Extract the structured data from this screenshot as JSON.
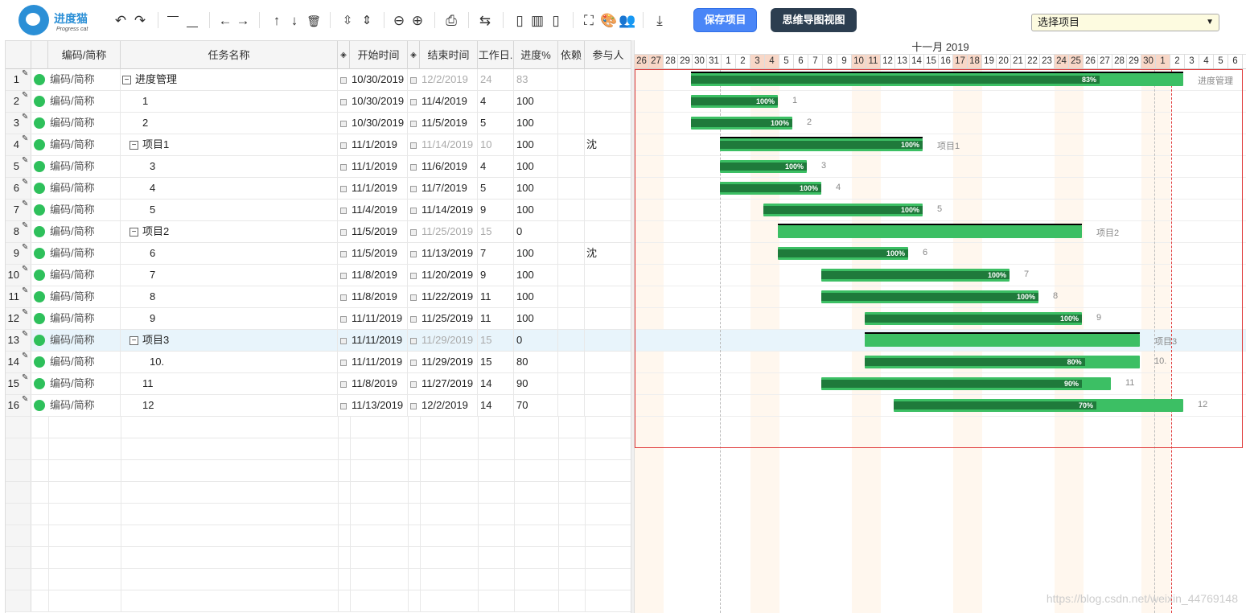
{
  "toolbar": {
    "logo_title": "进度猫",
    "logo_sub": "Progress cat",
    "save_label": "保存项目",
    "mind_label": "思维导图视图",
    "project_select": "选择项目"
  },
  "colors": {
    "bar": "#3cbf64",
    "progress": "#1f7a3b",
    "save_button": "#4a86f7",
    "mind_button": "#2c3e50",
    "status_dot": "#2ec05b",
    "weekend": "#f8d7c7"
  },
  "columns": [
    "编码/简称",
    "任务名称",
    "开始时间",
    "结束时间",
    "工作日.",
    "进度%",
    "依赖",
    "参与人"
  ],
  "tasks": [
    {
      "no": "1",
      "code": "编码/简称",
      "name": "进度管理",
      "start": "10/30/2019",
      "end": "12/2/2019",
      "days": "24",
      "progress": "83",
      "dep": "",
      "who": "",
      "summary": true,
      "level": 0,
      "bar_label": "83%",
      "side": "进度管理",
      "pct": 0.83
    },
    {
      "no": "2",
      "code": "编码/简称",
      "name": "1",
      "start": "10/30/2019",
      "end": "11/4/2019",
      "days": "4",
      "progress": "100",
      "dep": "",
      "who": "",
      "level": 1,
      "bar_label": "100%",
      "side": "1",
      "pct": 1
    },
    {
      "no": "3",
      "code": "编码/简称",
      "name": "2",
      "start": "10/30/2019",
      "end": "11/5/2019",
      "days": "5",
      "progress": "100",
      "dep": "",
      "who": "",
      "level": 1,
      "bar_label": "100%",
      "side": "2",
      "pct": 1
    },
    {
      "no": "4",
      "code": "编码/简称",
      "name": "项目1",
      "start": "11/1/2019",
      "end": "11/14/2019",
      "days": "10",
      "progress": "100",
      "dep": "",
      "who": "沈",
      "summary": true,
      "level": 1,
      "bar_label": "100%",
      "side": "项目1",
      "pct": 1
    },
    {
      "no": "5",
      "code": "编码/简称",
      "name": "3",
      "start": "11/1/2019",
      "end": "11/6/2019",
      "days": "4",
      "progress": "100",
      "dep": "",
      "who": "",
      "level": 2,
      "bar_label": "100%",
      "side": "3",
      "pct": 1
    },
    {
      "no": "6",
      "code": "编码/简称",
      "name": "4",
      "start": "11/1/2019",
      "end": "11/7/2019",
      "days": "5",
      "progress": "100",
      "dep": "",
      "who": "",
      "level": 2,
      "bar_label": "100%",
      "side": "4",
      "pct": 1
    },
    {
      "no": "7",
      "code": "编码/简称",
      "name": "5",
      "start": "11/4/2019",
      "end": "11/14/2019",
      "days": "9",
      "progress": "100",
      "dep": "",
      "who": "",
      "level": 2,
      "bar_label": "100%",
      "side": "5",
      "pct": 1
    },
    {
      "no": "8",
      "code": "编码/简称",
      "name": "项目2",
      "start": "11/5/2019",
      "end": "11/25/2019",
      "days": "15",
      "progress": "0",
      "dep": "",
      "who": "",
      "summary": true,
      "level": 1,
      "bar_label": "",
      "side": "项目2",
      "pct": 0
    },
    {
      "no": "9",
      "code": "编码/简称",
      "name": "6",
      "start": "11/5/2019",
      "end": "11/13/2019",
      "days": "7",
      "progress": "100",
      "dep": "",
      "who": "沈",
      "level": 2,
      "bar_label": "100%",
      "side": "6",
      "pct": 1
    },
    {
      "no": "10",
      "code": "编码/简称",
      "name": "7",
      "start": "11/8/2019",
      "end": "11/20/2019",
      "days": "9",
      "progress": "100",
      "dep": "",
      "who": "",
      "level": 2,
      "bar_label": "100%",
      "side": "7",
      "pct": 1
    },
    {
      "no": "11",
      "code": "编码/简称",
      "name": "8",
      "start": "11/8/2019",
      "end": "11/22/2019",
      "days": "11",
      "progress": "100",
      "dep": "",
      "who": "",
      "level": 2,
      "bar_label": "100%",
      "side": "8",
      "pct": 1
    },
    {
      "no": "12",
      "code": "编码/简称",
      "name": "9",
      "start": "11/11/2019",
      "end": "11/25/2019",
      "days": "11",
      "progress": "100",
      "dep": "",
      "who": "",
      "level": 2,
      "bar_label": "100%",
      "side": "9",
      "pct": 1
    },
    {
      "no": "13",
      "code": "编码/简称",
      "name": "项目3",
      "start": "11/11/2019",
      "end": "11/29/2019",
      "days": "15",
      "progress": "0",
      "dep": "",
      "who": "",
      "summary": true,
      "level": 1,
      "bar_label": "",
      "side": "项目3",
      "pct": 0,
      "selected": true
    },
    {
      "no": "14",
      "code": "编码/简称",
      "name": "10.",
      "start": "11/11/2019",
      "end": "11/29/2019",
      "days": "15",
      "progress": "80",
      "dep": "",
      "who": "",
      "level": 2,
      "bar_label": "80%",
      "side": "10.",
      "pct": 0.8
    },
    {
      "no": "15",
      "code": "编码/简称",
      "name": "11",
      "start": "11/8/2019",
      "end": "11/27/2019",
      "days": "14",
      "progress": "90",
      "dep": "",
      "who": "",
      "level": 1,
      "bar_label": "90%",
      "side": "11",
      "pct": 0.9
    },
    {
      "no": "16",
      "code": "编码/简称",
      "name": "12",
      "start": "11/13/2019",
      "end": "12/2/2019",
      "days": "14",
      "progress": "70",
      "dep": "",
      "who": "",
      "level": 1,
      "bar_label": "70%",
      "side": "12",
      "pct": 0.7
    }
  ],
  "timeline": {
    "month": "十一月 2019",
    "days": [
      "26",
      "27",
      "28",
      "29",
      "30",
      "31",
      "1",
      "2",
      "3",
      "4",
      "5",
      "6",
      "7",
      "8",
      "9",
      "10",
      "11",
      "12",
      "13",
      "14",
      "15",
      "16",
      "17",
      "18",
      "19",
      "20",
      "21",
      "22",
      "23",
      "24",
      "25",
      "26",
      "27",
      "28",
      "29",
      "30",
      "1",
      "2",
      "3",
      "4",
      "5",
      "6"
    ],
    "weekend_days": [
      "26",
      "27",
      "2",
      "3",
      "9",
      "10",
      "16",
      "17",
      "23",
      "24",
      "30",
      "1"
    ]
  },
  "watermark": "https://blog.csdn.net/weixin_44769148"
}
